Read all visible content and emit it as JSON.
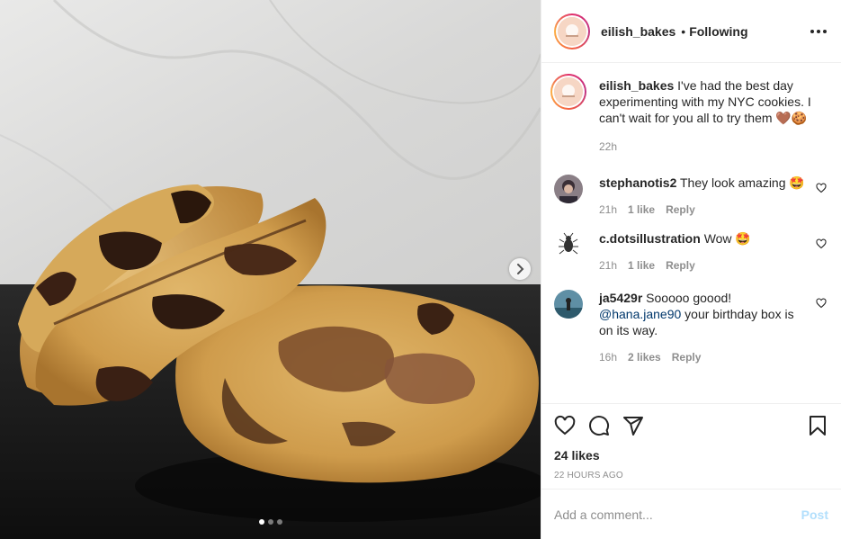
{
  "post": {
    "username": "eilish_bakes",
    "separator": "•",
    "follow_status": "Following",
    "caption": "I've had the best day experimenting with my NYC cookies. I can't wait for you all to try them 🤎🍪",
    "caption_time": "22h",
    "likes": "24 likes",
    "posted_ago": "22 HOURS AGO",
    "carousel_dots": 3,
    "active_dot": 0
  },
  "comments": [
    {
      "username": "stephanotis2",
      "text": "They look amazing 🤩",
      "mention": "",
      "text_after": "",
      "time": "21h",
      "likes": "1 like",
      "reply": "Reply"
    },
    {
      "username": "c.dotsillustration",
      "text": "Wow 🤩",
      "mention": "",
      "text_after": "",
      "time": "21h",
      "likes": "1 like",
      "reply": "Reply"
    },
    {
      "username": "ja5429r",
      "text": "Sooooo goood!",
      "mention": "@hana.jane90",
      "text_after": " your birthday box is on its way.",
      "time": "16h",
      "likes": "2 likes",
      "reply": "Reply"
    }
  ],
  "add_comment": {
    "placeholder": "Add a comment...",
    "post_label": "Post"
  },
  "icons": [
    "heart-icon",
    "comment-icon",
    "share-icon",
    "bookmark-icon",
    "more-options-icon",
    "chevron-right-icon"
  ],
  "colors": {
    "link": "#00376b",
    "post_disabled": "#b2dffc",
    "muted": "#8e8e8e",
    "text": "#262626"
  }
}
